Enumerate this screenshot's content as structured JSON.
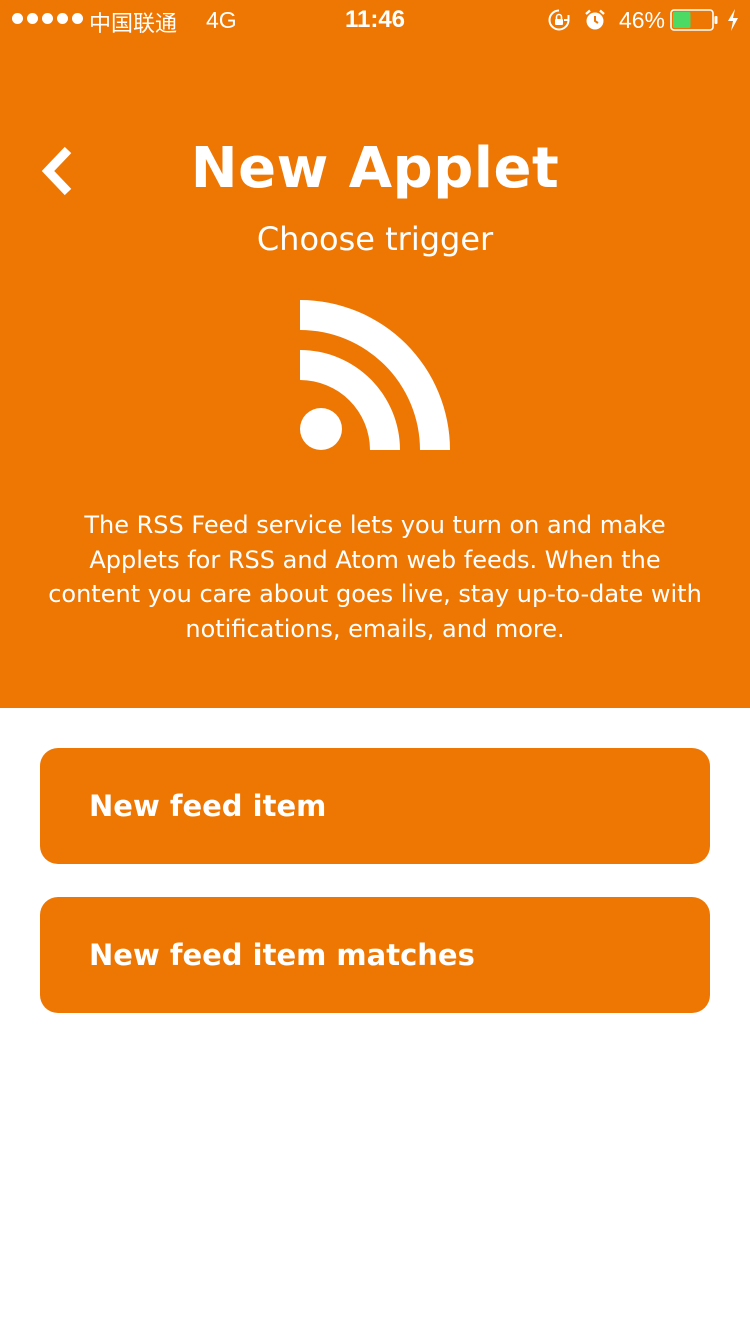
{
  "status_bar": {
    "carrier": "中国联通",
    "network": "4G",
    "time": "11:46",
    "battery_percent": "46%",
    "battery_level": 0.46,
    "battery_color": "#4CD964"
  },
  "header": {
    "back_icon": "chevron-left-icon",
    "title": "New Applet",
    "subtitle": "Choose trigger",
    "service_icon": "rss-icon",
    "description": "The RSS Feed service lets you turn on and make Applets for RSS and Atom web feeds. When the content you care about goes live, stay up-to-date with notifications, emails, and more."
  },
  "triggers": [
    {
      "label": "New feed item"
    },
    {
      "label": "New feed item matches"
    }
  ],
  "colors": {
    "brand": "#EE7704",
    "text_on_brand": "#FFFFFF",
    "background": "#FFFFFF"
  }
}
